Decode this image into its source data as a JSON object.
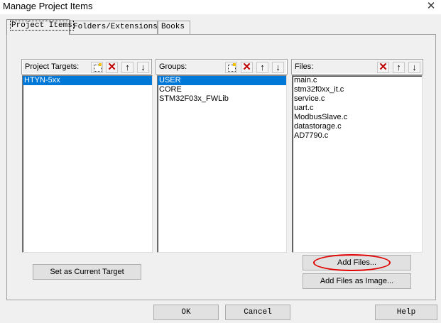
{
  "window": {
    "title": "Manage Project Items"
  },
  "tabs": [
    {
      "label": "Project Items"
    },
    {
      "label": "Folders/Extensions"
    },
    {
      "label": "Books"
    }
  ],
  "project_targets": {
    "label": "Project Targets:",
    "items": [
      "HTYN-5xx"
    ],
    "selected_index": 0
  },
  "groups": {
    "label": "Groups:",
    "items": [
      "USER",
      "CORE",
      "STM32F03x_FWLib"
    ],
    "selected_index": 0
  },
  "files": {
    "label": "Files:",
    "items": [
      "main.c",
      "stm32f0xx_it.c",
      "service.c",
      "uart.c",
      "ModbusSlave.c",
      "datastorage.c",
      "AD7790.c"
    ]
  },
  "buttons": {
    "set_current_target": "Set as Current Target",
    "add_files": "Add Files...",
    "add_files_as_image": "Add Files as Image...",
    "ok": "OK",
    "cancel": "Cancel",
    "help": "Help"
  },
  "icons": {
    "new": "new-item-icon",
    "delete": "delete-icon",
    "up": "move-up-icon",
    "down": "move-down-icon",
    "close": "close-icon"
  },
  "colors": {
    "selection": "#0078d7",
    "delete": "#c00000",
    "annotation": "#e00000"
  }
}
